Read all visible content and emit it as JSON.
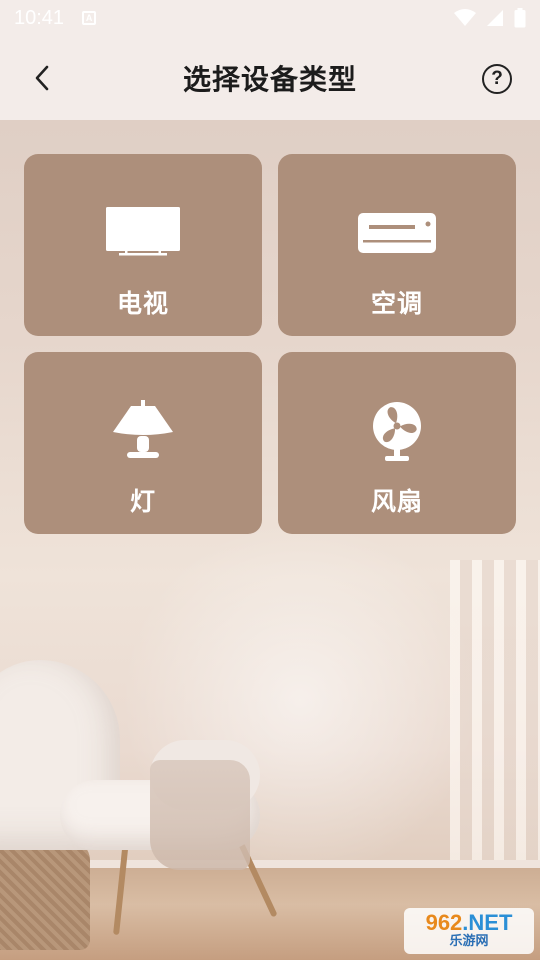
{
  "status_bar": {
    "time": "10:41"
  },
  "header": {
    "title": "选择设备类型"
  },
  "devices": [
    {
      "label": "电视",
      "icon": "tv-icon"
    },
    {
      "label": "空调",
      "icon": "air-conditioner-icon"
    },
    {
      "label": "灯",
      "icon": "lamp-icon"
    },
    {
      "label": "风扇",
      "icon": "fan-icon"
    }
  ],
  "watermark": {
    "brand": "962",
    "suffix": ".NET",
    "sub": "乐游网"
  },
  "colors": {
    "card": "#ad8f7b",
    "header_bg": "#f3ece9",
    "title_text": "#1c1c1c"
  }
}
